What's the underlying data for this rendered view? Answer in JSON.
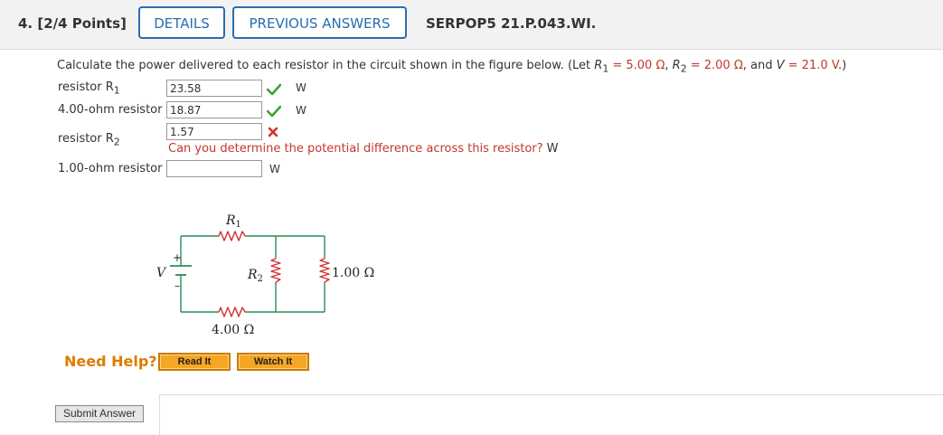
{
  "header": {
    "question_number": "4. [2/4 Points]",
    "details_label": "DETAILS",
    "previous_answers_label": "PREVIOUS ANSWERS",
    "problem_code": "SERPOP5 21.P.043.WI."
  },
  "question": {
    "text_before": "Calculate the power delivered to each resistor in the circuit shown in the figure below. (Let ",
    "r1_symbol": "R",
    "r1_sub": "1",
    "r1_eq": " = 5.00 Ω",
    "sep1": ", ",
    "r2_symbol": "R",
    "r2_sub": "2",
    "r2_eq": " = 2.00 Ω",
    "sep2": ", and ",
    "v_symbol": "V",
    "v_eq": " = 21.0 V",
    "text_after": ".)"
  },
  "answers": [
    {
      "label": "resistor R",
      "sub": "1",
      "value": "23.58",
      "unit": "W",
      "status": "correct"
    },
    {
      "label": "4.00-ohm resistor",
      "value": "18.87",
      "unit": "W",
      "status": "correct"
    },
    {
      "label": "resistor R",
      "sub": "2",
      "value": "1.57",
      "status": "incorrect",
      "hint": "Can you determine the potential difference across this resistor?",
      "unit": "W"
    },
    {
      "label": "1.00-ohm resistor",
      "value": "",
      "unit": "W",
      "status": "unanswered"
    }
  ],
  "circuit": {
    "r1_label": "R",
    "r1_sub": "1",
    "r2_label": "R",
    "r2_sub": "2",
    "v_label": "V",
    "plus": "+",
    "minus": "–",
    "r4_label": "4.00 Ω",
    "r1ohm_label": "1.00 Ω"
  },
  "help": {
    "need_help": "Need Help?",
    "read_it": "Read It",
    "watch_it": "Watch It"
  },
  "submit": {
    "label": "Submit Answer"
  },
  "colors": {
    "accent_blue": "#2a6db0",
    "given_red": "#c0392b",
    "help_orange": "#e07b00",
    "check_green": "#3aa335",
    "circuit_green": "#2e8b57",
    "resistor_red": "#d32f2f"
  }
}
